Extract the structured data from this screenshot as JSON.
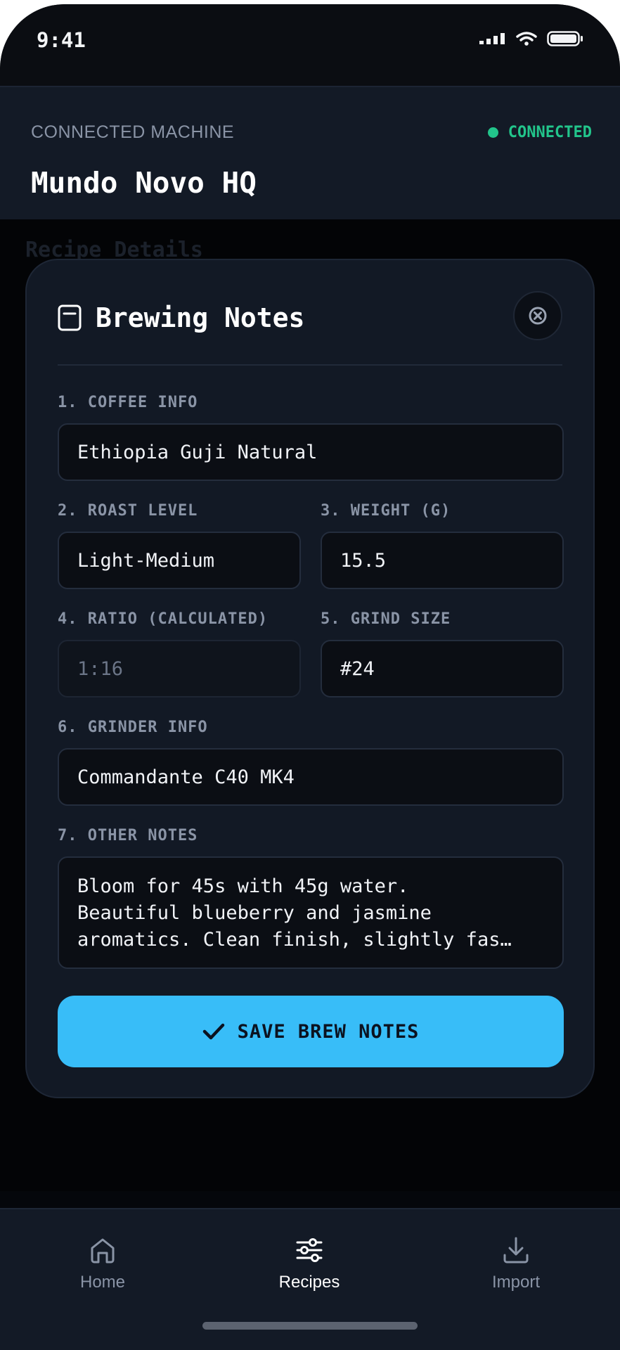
{
  "status_bar": {
    "time": "9:41"
  },
  "header": {
    "label": "CONNECTED MACHINE",
    "machine_name": "Mundo Novo HQ",
    "connection_status": "CONNECTED",
    "status_color": "#22c58b"
  },
  "background": {
    "section_title": "Recipe Details"
  },
  "modal": {
    "icon": "document-icon",
    "title": "Brewing Notes",
    "close_icon": "close-circle-icon",
    "fields": {
      "coffee_info": {
        "label": "1. COFFEE INFO",
        "value": "Ethiopia Guji Natural"
      },
      "roast_level": {
        "label": "2. ROAST LEVEL",
        "value": "Light-Medium"
      },
      "weight": {
        "label": "3. WEIGHT (G)",
        "value": "15.5"
      },
      "ratio": {
        "label": "4. RATIO (CALCULATED)",
        "value": "1:16"
      },
      "grind_size": {
        "label": "5. GRIND SIZE",
        "value": "#24"
      },
      "grinder_info": {
        "label": "6. GRINDER INFO",
        "value": "Commandante C40 MK4"
      },
      "other_notes": {
        "label": "7. OTHER NOTES",
        "value": "Bloom for 45s with 45g water.\nBeautiful blueberry and jasmine\naromatics. Clean finish, slightly fas…"
      }
    },
    "save_button": {
      "label": "SAVE BREW NOTES",
      "icon": "check-icon",
      "color": "#38bdf8"
    }
  },
  "tab_bar": {
    "items": [
      {
        "label": "Home",
        "icon": "home-icon",
        "active": false
      },
      {
        "label": "Recipes",
        "icon": "sliders-icon",
        "active": true
      },
      {
        "label": "Import",
        "icon": "download-icon",
        "active": false
      }
    ]
  }
}
